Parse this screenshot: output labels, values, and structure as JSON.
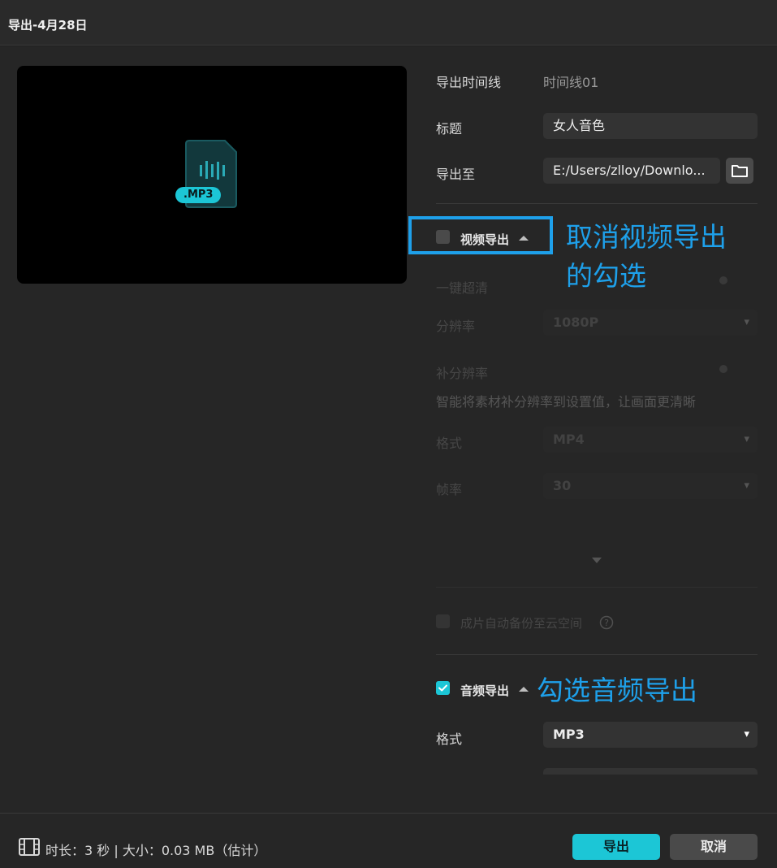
{
  "window": {
    "title": "导出-4月28日"
  },
  "preview": {
    "file_badge": ".MP3",
    "file_icon": "audio-file-icon"
  },
  "general": {
    "timeline_label": "导出时间线",
    "timeline_value": "时间线01",
    "title_label": "标题",
    "title_value": "女人音色",
    "export_to_label": "导出至",
    "export_to_value": "E:/Users/zlloy/Downlo..."
  },
  "video_export": {
    "checked": false,
    "label": "视频导出",
    "one_click_hd_label": "一键超清",
    "resolution_label": "分辨率",
    "resolution_value": "1080P",
    "super_resolution_label": "补分辨率",
    "super_resolution_desc": "智能将素材补分辨率到设置值，让画面更清晰",
    "format_label": "格式",
    "format_value": "MP4",
    "framerate_label": "帧率",
    "framerate_value": "30",
    "backup_label": "成片自动备份至云空间"
  },
  "audio_export": {
    "checked": true,
    "label": "音频导出",
    "format_label": "格式",
    "format_value": "MP3"
  },
  "annotations": {
    "uncheck_video": [
      "取消视频导出",
      "的勾选"
    ],
    "check_audio": "勾选音频导出"
  },
  "footer": {
    "info": "时长：3 秒 | 大小：0.03 MB（估计）",
    "export_button": "导出",
    "cancel_button": "取消"
  },
  "colors": {
    "accent": "#1cc6d6",
    "annotation": "#1ea0ea",
    "background": "#262626"
  }
}
